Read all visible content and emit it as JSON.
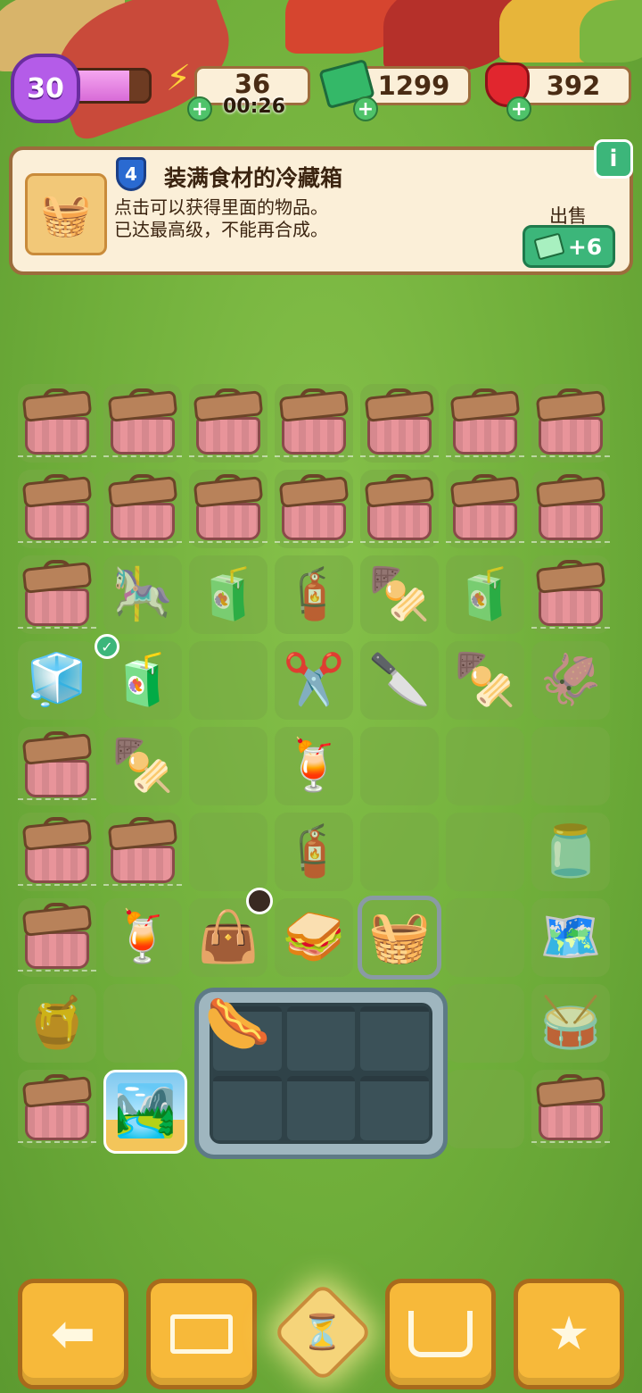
{
  "resources": {
    "level": "30",
    "xp_fraction": 0.77,
    "energy": "36",
    "energy_timer": "00:26",
    "cash": "1299",
    "gems": "392"
  },
  "info_panel": {
    "item_level": "4",
    "item_name": "装满食材的冷藏箱",
    "description_line1": "点击可以获得里面的物品。",
    "description_line2": "已达最高级，不能再合成。",
    "sell_label": "出售",
    "sell_value": "+6",
    "info_icon": "i"
  },
  "colors": {
    "accent_green": "#3cb67a",
    "panel_bg": "#fbefd8",
    "button_orange": "#f7b93a"
  },
  "board": {
    "rows": [
      [
        "basket",
        "basket",
        "basket",
        "basket",
        "basket",
        "basket",
        "basket"
      ],
      [
        "basket",
        "basket",
        "basket",
        "basket",
        "basket",
        "basket",
        "basket"
      ],
      [
        "basket",
        "tent-carousel",
        "juice-bottle",
        "matchbox",
        "skewer",
        "juice-bottle",
        "basket"
      ],
      [
        "cooler",
        "juice-bottle-checked",
        "empty",
        "scissors",
        "knife",
        "skewer",
        "squid-skewer"
      ],
      [
        "basket",
        "skewer",
        "empty",
        "juice-glass",
        "empty",
        "empty",
        "empty"
      ],
      [
        "basket",
        "basket",
        "empty",
        "matchbox",
        "empty",
        "empty",
        "water-dispenser"
      ],
      [
        "basket",
        "juice-glass",
        "lunch-bag",
        "picnic-set",
        "cooler-full-selected",
        "empty",
        "picnic-mat"
      ],
      [
        "syrup-bottle",
        "empty",
        "tray",
        "tray",
        "tray",
        "empty",
        "drum"
      ],
      [
        "basket",
        "landscape-card",
        "tray",
        "tray",
        "tray",
        "empty",
        "basket"
      ]
    ]
  },
  "bottom_bar": {
    "back_icon": "back-arrow-icon",
    "leaderboard_icon": "podium-icon",
    "hourglass_icon": "hourglass-icon",
    "shop_icon": "basket-icon",
    "tasks_icon": "clipboard-star-icon"
  }
}
